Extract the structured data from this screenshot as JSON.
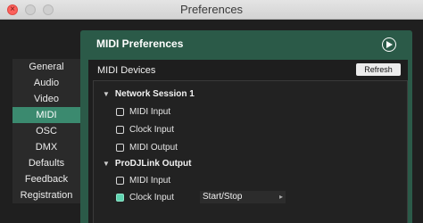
{
  "window": {
    "title": "Preferences"
  },
  "sidebar": {
    "items": [
      {
        "label": "General"
      },
      {
        "label": "Audio"
      },
      {
        "label": "Video"
      },
      {
        "label": "MIDI"
      },
      {
        "label": "OSC"
      },
      {
        "label": "DMX"
      },
      {
        "label": "Defaults"
      },
      {
        "label": "Feedback"
      },
      {
        "label": "Registration"
      }
    ],
    "selected": "MIDI"
  },
  "panel": {
    "title": "MIDI Preferences",
    "devices_title": "MIDI Devices",
    "refresh_label": "Refresh"
  },
  "groups": [
    {
      "name": "Network Session 1",
      "options": [
        {
          "label": "MIDI Input",
          "checked": false
        },
        {
          "label": "Clock Input",
          "checked": false
        },
        {
          "label": "MIDI Output",
          "checked": false
        }
      ]
    },
    {
      "name": "ProDJLink Output",
      "options": [
        {
          "label": "MIDI Input",
          "checked": false
        },
        {
          "label": "Clock Input",
          "checked": true,
          "mode": "Start/Stop"
        }
      ]
    }
  ],
  "colors": {
    "accent": "#3b8a6f",
    "panel": "#2b5a48",
    "checkbox_on": "#5fd4b0"
  }
}
